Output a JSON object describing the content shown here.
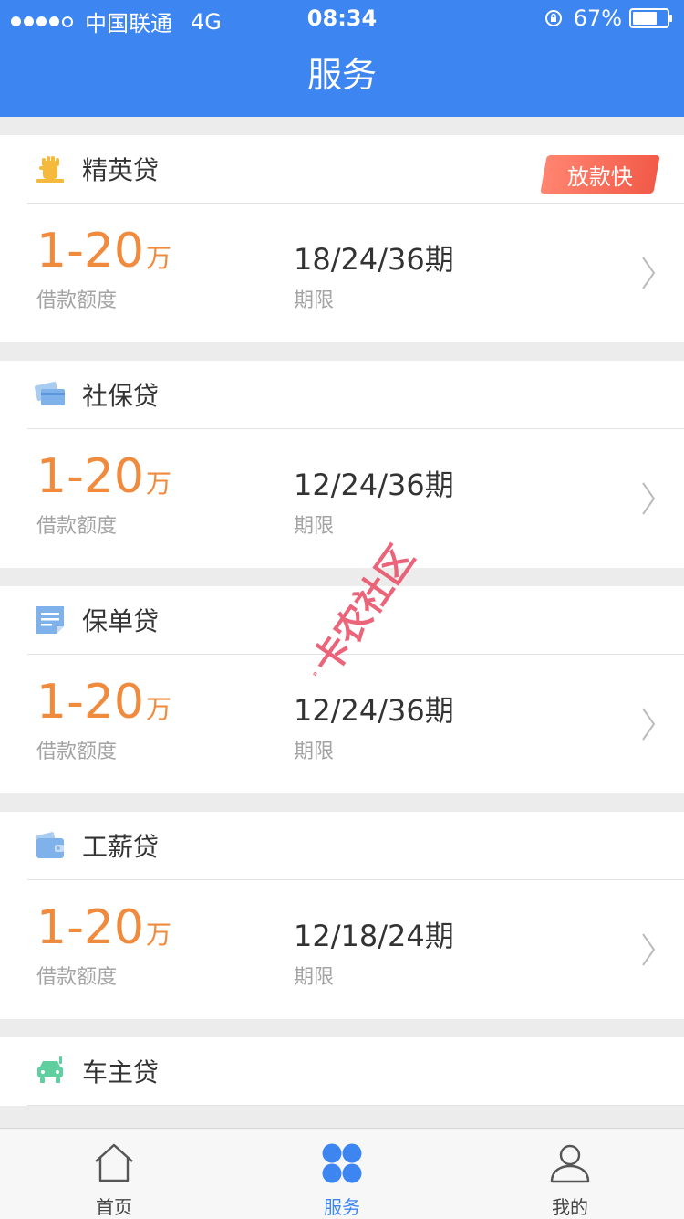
{
  "status_bar": {
    "carrier": "中国联通",
    "network": "4G",
    "time": "08:34",
    "battery": "67%"
  },
  "header": {
    "title": "服务"
  },
  "colors": {
    "primary": "#3d86f2",
    "amount": "#f08a3d",
    "tag": "#f25a48",
    "watermark": "#e9546b"
  },
  "products": [
    {
      "name": "精英贷",
      "icon": "raised-fist-icon",
      "tag": "放款快",
      "amount": "1-20",
      "amount_unit": "万",
      "amount_label": "借款额度",
      "term": "18/24/36",
      "term_unit": "期",
      "term_label": "期限"
    },
    {
      "name": "社保贷",
      "icon": "social-security-card-icon",
      "amount": "1-20",
      "amount_unit": "万",
      "amount_label": "借款额度",
      "term": "12/24/36",
      "term_unit": "期",
      "term_label": "期限"
    },
    {
      "name": "保单贷",
      "icon": "policy-document-icon",
      "amount": "1-20",
      "amount_unit": "万",
      "amount_label": "借款额度",
      "term": "12/24/36",
      "term_unit": "期",
      "term_label": "期限"
    },
    {
      "name": "工薪贷",
      "icon": "wallet-icon",
      "amount": "1-20",
      "amount_unit": "万",
      "amount_label": "借款额度",
      "term": "12/18/24",
      "term_unit": "期",
      "term_label": "期限"
    },
    {
      "name": "车主贷",
      "icon": "car-icon"
    }
  ],
  "watermark": {
    "text": "卡农社区"
  },
  "tabbar": {
    "items": [
      {
        "label": "首页",
        "icon": "home-icon",
        "active": false
      },
      {
        "label": "服务",
        "icon": "service-grid-icon",
        "active": true
      },
      {
        "label": "我的",
        "icon": "user-icon",
        "active": false
      }
    ]
  }
}
